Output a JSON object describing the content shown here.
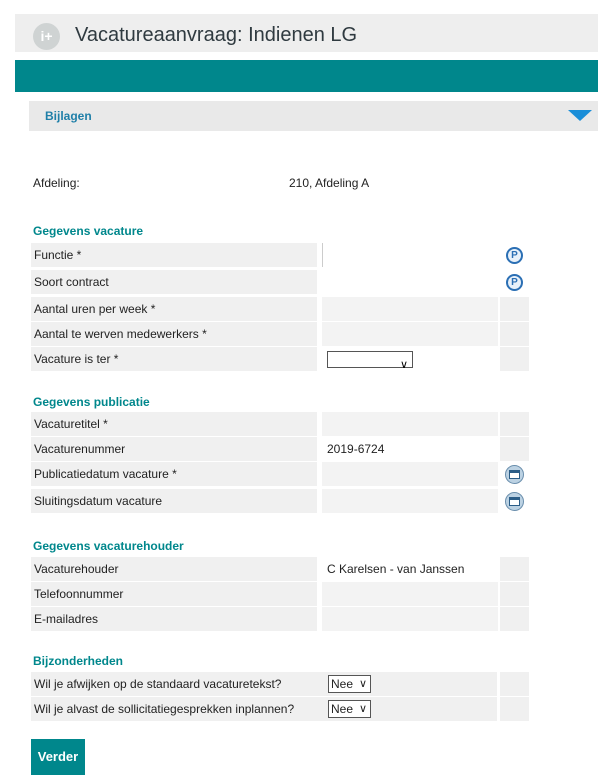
{
  "window": {
    "title": "Vacatureaanvraag: Indienen LG",
    "logo_text": "i+"
  },
  "section": {
    "label": "Bijlagen"
  },
  "afdeling": {
    "label": "Afdeling:",
    "value": "210, Afdeling A"
  },
  "groups": {
    "vacature": {
      "title": "Gegevens vacature",
      "functie": {
        "label": "Functie *",
        "value": ""
      },
      "soort_contract": {
        "label": "Soort contract",
        "value": ""
      },
      "uren": {
        "label": "Aantal uren per week *",
        "value": ""
      },
      "medewerkers": {
        "label": "Aantal te werven medewerkers *",
        "value": ""
      },
      "ter": {
        "label": "Vacature is ter *",
        "selected": ""
      }
    },
    "publicatie": {
      "title": "Gegevens publicatie",
      "titel": {
        "label": "Vacaturetitel *",
        "value": ""
      },
      "nummer": {
        "label": "Vacaturenummer",
        "value": "2019-6724"
      },
      "publicatiedatum": {
        "label": "Publicatiedatum vacature *",
        "value": ""
      },
      "sluitingsdatum": {
        "label": "Sluitingsdatum vacature",
        "value": ""
      }
    },
    "houder": {
      "title": "Gegevens vacaturehouder",
      "naam": {
        "label": "Vacaturehouder",
        "value": "C Karelsen - van Janssen"
      },
      "telefoon": {
        "label": "Telefoonnummer",
        "value": ""
      },
      "email": {
        "label": "E-mailadres",
        "value": ""
      }
    },
    "bijzonderheden": {
      "title": "Bijzonderheden",
      "afwijken": {
        "label": "Wil je afwijken op de standaard vacaturetekst?",
        "selected": "Nee"
      },
      "inplannen": {
        "label": "Wil je alvast de sollicitatiegesprekken inplannen?",
        "selected": "Nee"
      }
    }
  },
  "buttons": {
    "verder": "Verder"
  },
  "icons": {
    "lookup": "lookup-icon",
    "calendar": "calendar-icon",
    "collapse": "triangle-down-icon"
  },
  "colors": {
    "accent": "#00878c",
    "section_label": "#1f7fa8",
    "arrow": "#1a8ed8"
  }
}
